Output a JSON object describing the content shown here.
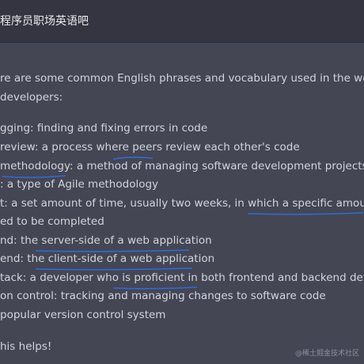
{
  "header": {
    "title": "程序员职场英语吧"
  },
  "message": {
    "intro_line1": "re are some common English phrases and vocabulary used in the workplace fo",
    "intro_line2": " developers:",
    "items": [
      "gging: finding and fixing errors in code",
      " review: a process where peers review each other's code",
      " methodology: a method of managing software development projects",
      ": a type of Agile methodology",
      "t: a set amount of time, usually two weeks, in which a specific amount of work",
      "ed to be completed",
      "nd: the server-side of a web application",
      "end: the client-side of a web application",
      "tack: a developer who is proficient in both frontend and backend development",
      "on control: tracking and managing changes to software code",
      " popular version control system"
    ],
    "closing": "his helps!"
  },
  "watermark": "@稀土掘金技术社区",
  "colors": {
    "background": "#444654",
    "header_background": "#343541",
    "text": "#d1d5db",
    "underline": "#2f6bd8"
  }
}
